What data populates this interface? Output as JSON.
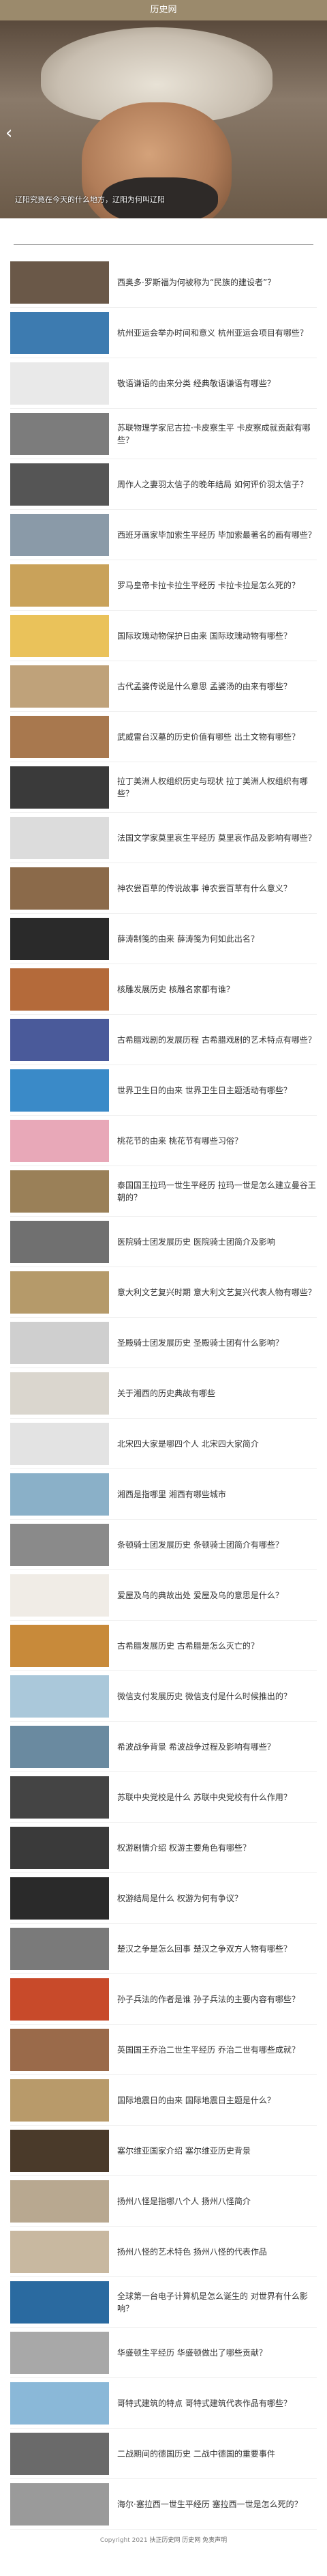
{
  "header": {
    "title": "历史网"
  },
  "hero": {
    "caption": "辽阳究竟在今天的什么地方，辽阳为何叫辽阳"
  },
  "footer": {
    "copyright": "Copyright 2021",
    "brand": "扶正历史网 历史网 免责声明"
  },
  "items": [
    {
      "title": "西奥多·罗斯福为何被称为“民族的建设者”？",
      "color": "#6a5848"
    },
    {
      "title": "杭州亚运会举办时间和意义 杭州亚运会项目有哪些？",
      "color": "#3d7bb0"
    },
    {
      "title": "敬语谦语的由来分类 经典敬语谦语有哪些？",
      "color": "#e9e9e9"
    },
    {
      "title": "苏联物理学家尼古拉·卡皮察生平 卡皮察成就贡献有哪些？",
      "color": "#7c7c7c"
    },
    {
      "title": "周作人之妻羽太信子的晚年结局 如何评价羽太信子？",
      "color": "#555555"
    },
    {
      "title": "西班牙画家毕加索生平经历 毕加索最著名的画有哪些？",
      "color": "#8a9aa8"
    },
    {
      "title": "罗马皇帝卡拉卡拉生平经历 卡拉卡拉是怎么死的？",
      "color": "#c9a25a"
    },
    {
      "title": "国际玫瑰动物保护日由来 国际玫瑰动物有哪些？",
      "color": "#eac25a"
    },
    {
      "title": "古代孟婆传说是什么意思 孟婆汤的由来有哪些？",
      "color": "#bfa27a"
    },
    {
      "title": "武威雷台汉墓的历史价值有哪些 出土文物有哪些？",
      "color": "#a8784e"
    },
    {
      "title": "拉丁美洲人权组织历史与现状 拉丁美洲人权组织有哪些？",
      "color": "#3a3a3a"
    },
    {
      "title": "法国文学家莫里哀生平经历 莫里哀作品及影响有哪些？",
      "color": "#dcdcdc"
    },
    {
      "title": "神农尝百草的传说故事 神农尝百草有什么意义？",
      "color": "#8b6a4a"
    },
    {
      "title": "薛涛制笺的由来 薛涛笺为何如此出名？",
      "color": "#2a2a2a"
    },
    {
      "title": "核雕发展历史 核雕名家都有谁？",
      "color": "#b46a3a"
    },
    {
      "title": "古希腊戏剧的发展历程 古希腊戏剧的艺术特点有哪些？",
      "color": "#4a5a9a"
    },
    {
      "title": "世界卫生日的由来 世界卫生日主题活动有哪些？",
      "color": "#3a8ac8"
    },
    {
      "title": "桃花节的由来 桃花节有哪些习俗？",
      "color": "#e8a8b8"
    },
    {
      "title": "泰国国王拉玛一世生平经历 拉玛一世是怎么建立曼谷王朝的？",
      "color": "#9a8058"
    },
    {
      "title": "医院骑士团发展历史 医院骑士团简介及影响",
      "color": "#707070"
    },
    {
      "title": "意大利文艺复兴时期 意大利文艺复兴代表人物有哪些？",
      "color": "#b59a6a"
    },
    {
      "title": "圣殿骑士团发展历史 圣殿骑士团有什么影响？",
      "color": "#cfcfcf"
    },
    {
      "title": "关于湘西的历史典故有哪些",
      "color": "#dad6ce"
    },
    {
      "title": "北宋四大家是哪四个人 北宋四大家简介",
      "color": "#e3e3e3"
    },
    {
      "title": "湘西是指哪里 湘西有哪些城市",
      "color": "#8ab0c8"
    },
    {
      "title": "条顿骑士团发展历史 条顿骑士团简介有哪些？",
      "color": "#8a8a8a"
    },
    {
      "title": "爱屋及乌的典故出处 爱屋及乌的意思是什么？",
      "color": "#f0ece6"
    },
    {
      "title": "古希腊发展历史 古希腊是怎么灭亡的？",
      "color": "#c88a3a"
    },
    {
      "title": "微信支付发展历史 微信支付是什么时候推出的？",
      "color": "#aac8da"
    },
    {
      "title": "希波战争背景 希波战争过程及影响有哪些？",
      "color": "#6a8aa0"
    },
    {
      "title": "苏联中央党校是什么 苏联中央党校有什么作用？",
      "color": "#444444"
    },
    {
      "title": "权游剧情介绍 权游主要角色有哪些？",
      "color": "#3a3a3a"
    },
    {
      "title": "权游结局是什么 权游为何有争议？",
      "color": "#2a2a2a"
    },
    {
      "title": "楚汉之争是怎么回事 楚汉之争双方人物有哪些？",
      "color": "#7a7a7a"
    },
    {
      "title": "孙子兵法的作者是谁 孙子兵法的主要内容有哪些？",
      "color": "#c84a2a"
    },
    {
      "title": "英国国王乔治二世生平经历 乔治二世有哪些成就？",
      "color": "#9a6a4a"
    },
    {
      "title": "国际地震日的由来 国际地震日主题是什么？",
      "color": "#b89a6a"
    },
    {
      "title": "塞尔维亚国家介绍 塞尔维亚历史背景",
      "color": "#4a3a2a"
    },
    {
      "title": "扬州八怪是指哪八个人 扬州八怪简介",
      "color": "#b8a890"
    },
    {
      "title": "扬州八怪的艺术特色 扬州八怪的代表作品",
      "color": "#c8b8a0"
    },
    {
      "title": "全球第一台电子计算机是怎么诞生的 对世界有什么影响？",
      "color": "#2a6aa0"
    },
    {
      "title": "华盛顿生平经历 华盛顿做出了哪些贡献？",
      "color": "#a8a8a8"
    },
    {
      "title": "哥特式建筑的特点 哥特式建筑代表作品有哪些？",
      "color": "#8ab8d8"
    },
    {
      "title": "二战期间的德国历史 二战中德国的重要事件",
      "color": "#6a6a6a"
    },
    {
      "title": "海尔·塞拉西一世生平经历 塞拉西一世是怎么死的？",
      "color": "#9a9a9a"
    }
  ]
}
